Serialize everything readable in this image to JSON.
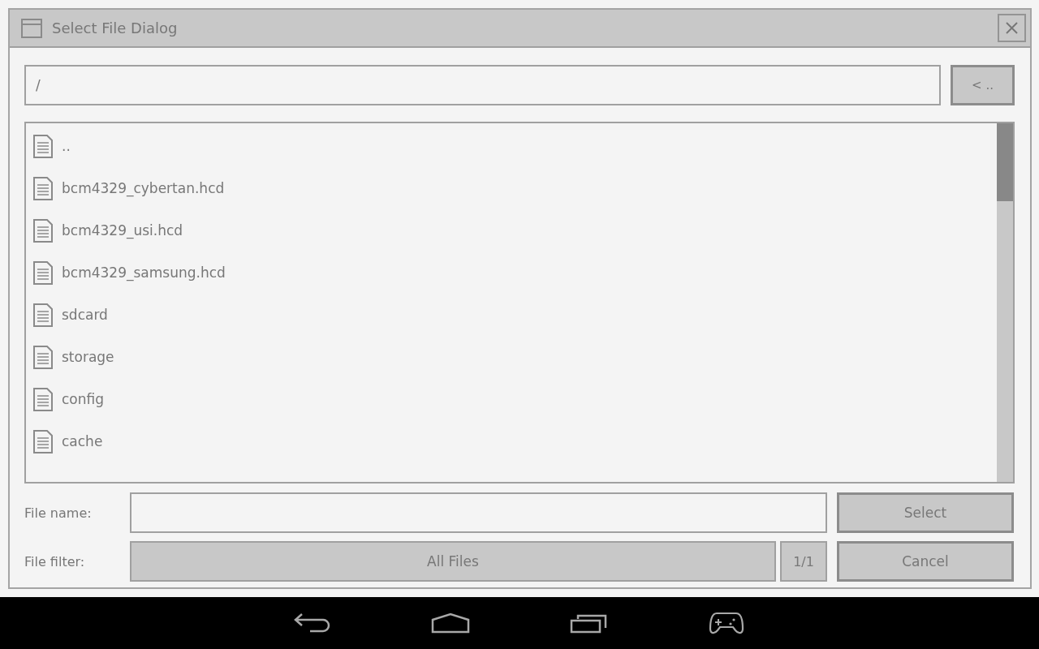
{
  "window": {
    "title": "Select File Dialog"
  },
  "path_field": {
    "value": "/"
  },
  "up_button": {
    "label": "< .."
  },
  "file_list": {
    "items": [
      {
        "name": ".."
      },
      {
        "name": "bcm4329_cybertan.hcd"
      },
      {
        "name": "bcm4329_usi.hcd"
      },
      {
        "name": "bcm4329_samsung.hcd"
      },
      {
        "name": "sdcard"
      },
      {
        "name": "storage"
      },
      {
        "name": "config"
      },
      {
        "name": "cache"
      }
    ]
  },
  "file_name": {
    "label": "File name:"
  },
  "file_filter": {
    "label": "File filter:",
    "value": "All Files",
    "page": "1/1"
  },
  "buttons": [
    {
      "label": "Select"
    },
    {
      "label": "Cancel"
    }
  ]
}
